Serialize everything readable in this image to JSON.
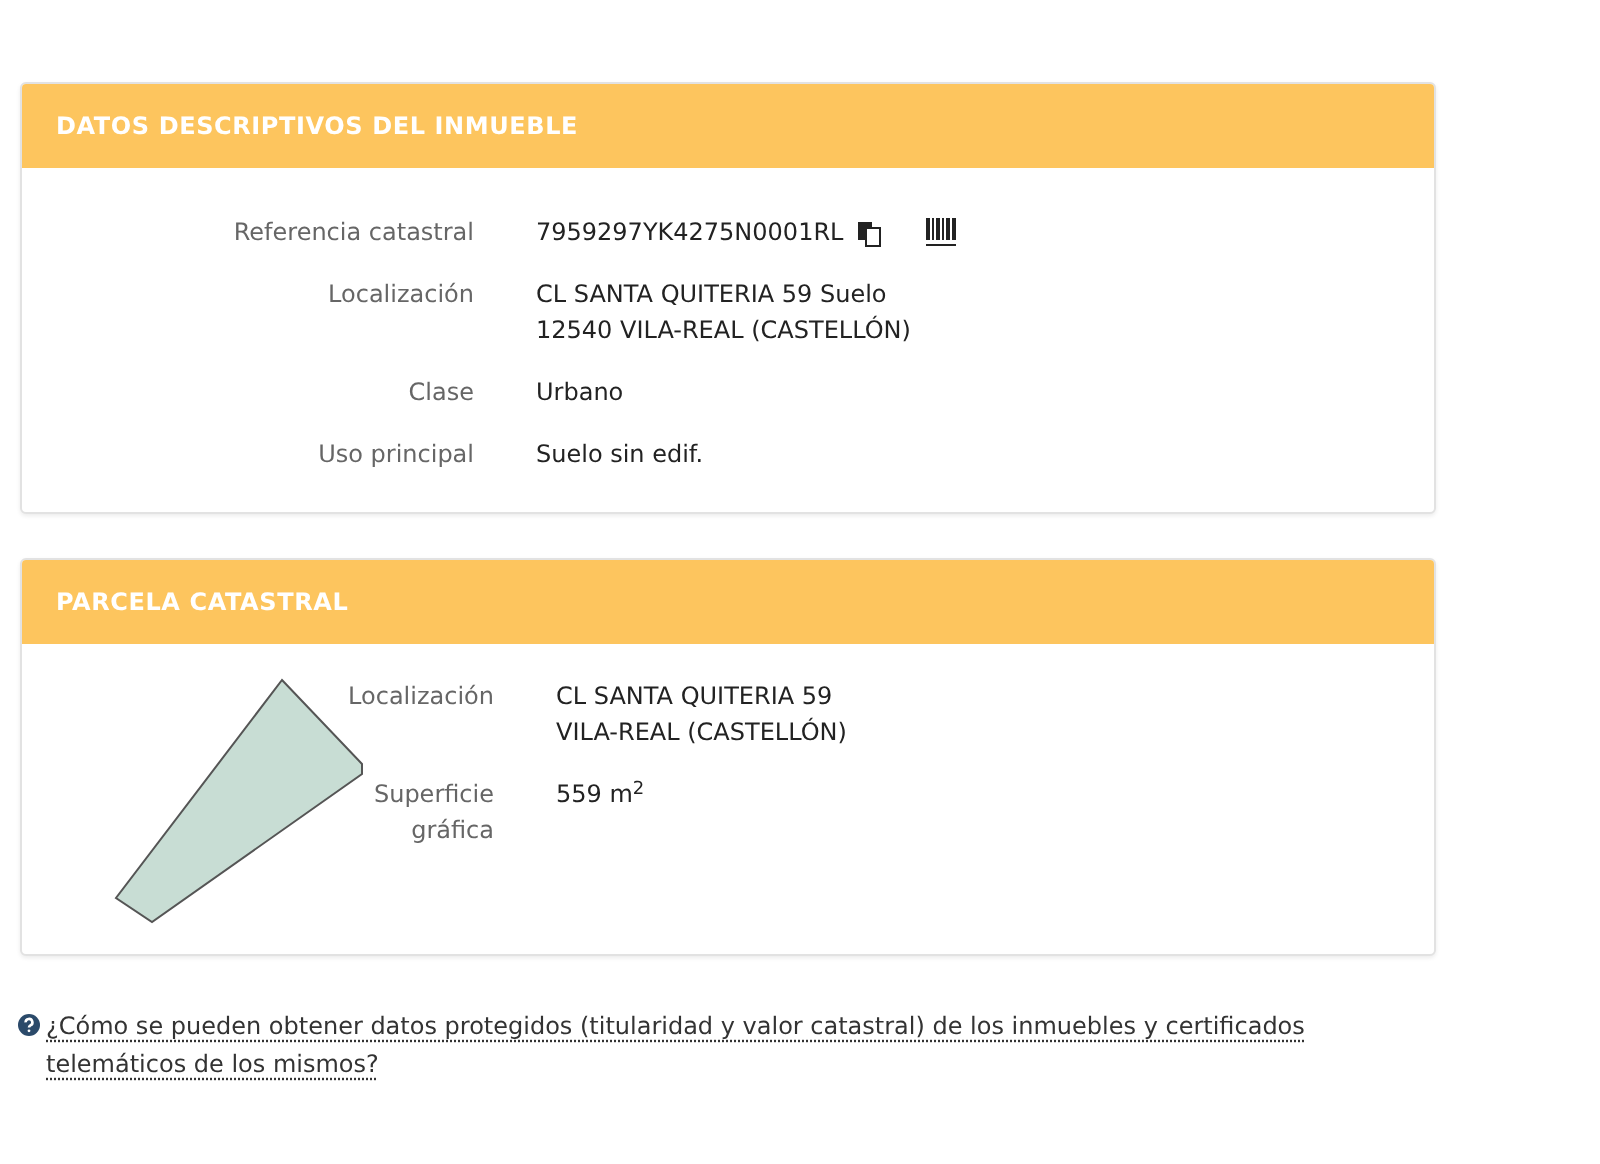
{
  "cards": [
    {
      "title": "DATOS DESCRIPTIVOS DEL INMUEBLE",
      "kind": "fields",
      "rows": [
        {
          "label": "Referencia catastral",
          "lines": [
            "7959297YK4275N0001RL"
          ],
          "icons": true
        },
        {
          "label": "Localización",
          "lines": [
            "CL SANTA QUITERIA 59 Suelo",
            "12540 VILA-REAL (CASTELLÓN)"
          ]
        },
        {
          "label": "Clase",
          "lines": [
            "Urbano"
          ]
        },
        {
          "label": "Uso principal",
          "lines": [
            "Suelo sin edif."
          ]
        }
      ]
    },
    {
      "title": "PARCELA CATASTRAL",
      "kind": "parcel",
      "rows": [
        {
          "label": "Localización",
          "lines": [
            "CL SANTA QUITERIA 59",
            "VILA-REAL (CASTELLÓN)"
          ]
        },
        {
          "label": "Superficie gráfica",
          "lines": [
            "559 m$^{2}$"
          ]
        }
      ]
    }
  ],
  "help_link": "¿Cómo se pueden obtener datos protegidos (titularidad y valor catastral) de los inmuebles y certificados telemáticos de los mismos?"
}
